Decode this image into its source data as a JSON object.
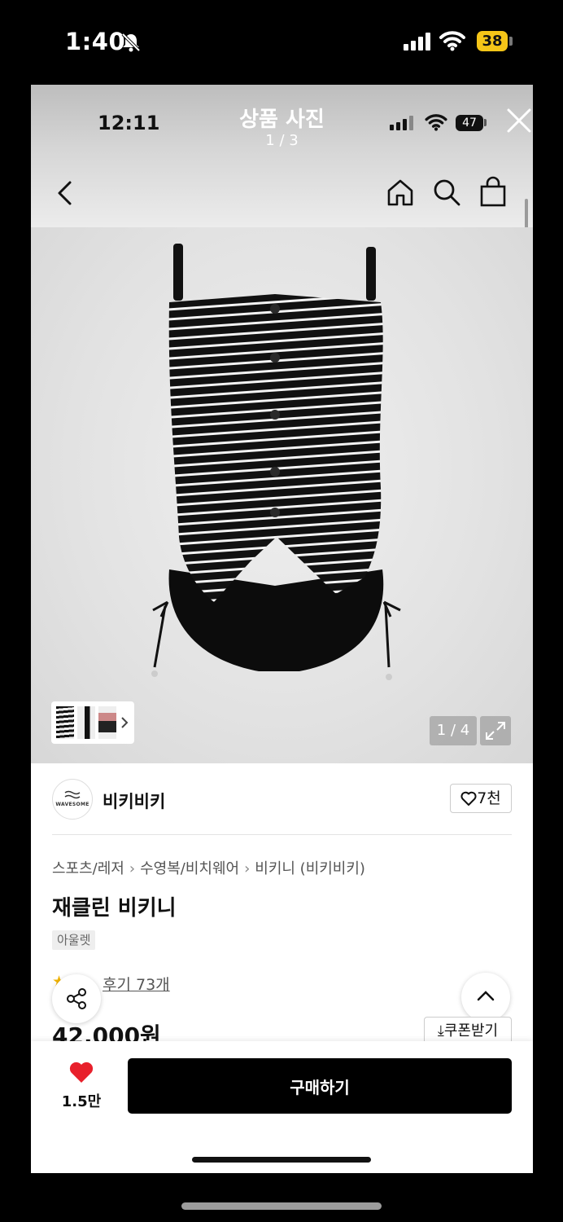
{
  "outer_status": {
    "time": "1:40",
    "battery": "38"
  },
  "viewer": {
    "inner_time": "12:11",
    "title": "상품 사진",
    "counter": "1 / 3",
    "inner_battery": "47",
    "page_indicator": "1 / 4"
  },
  "brand": {
    "logo_text": "WAVESOME",
    "name": "비키비키",
    "likes": "7천"
  },
  "breadcrumbs": [
    "스포츠/레저",
    "수영복/비치웨어",
    "비키니 (비키비키)"
  ],
  "product": {
    "title": "재클린 비키니",
    "tag": "아울렛",
    "review_link": "후기 73개",
    "price": "42,000원",
    "coupon_label": "쿠폰받기"
  },
  "bottom_bar": {
    "wish_count": "1.5만",
    "buy_label": "구매하기"
  },
  "colors": {
    "accent": "#e8202b",
    "primary": "#000000",
    "battery": "#f5c518"
  }
}
